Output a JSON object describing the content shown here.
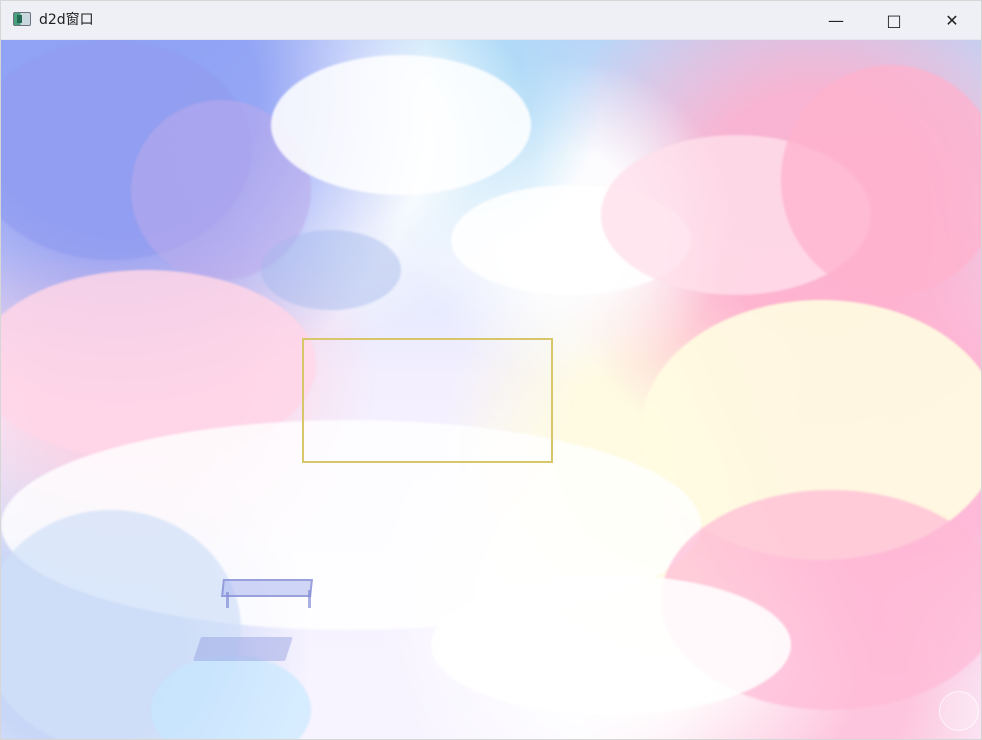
{
  "window": {
    "title": "d2d窗口",
    "controls": {
      "minimize": "—",
      "maximize": "□",
      "close": "✕"
    }
  },
  "content": {
    "background_scene": "pastel-cloud-sky",
    "selection_color": "#d8c66b"
  },
  "colors": {
    "titlebar": "#eef0f5",
    "text": "#1f1f1f",
    "sky_blue": "#b9d6f8",
    "cloud_pink": "#ffb1cc",
    "cloud_violet": "#919df0",
    "cloud_cream": "#fffce2"
  }
}
